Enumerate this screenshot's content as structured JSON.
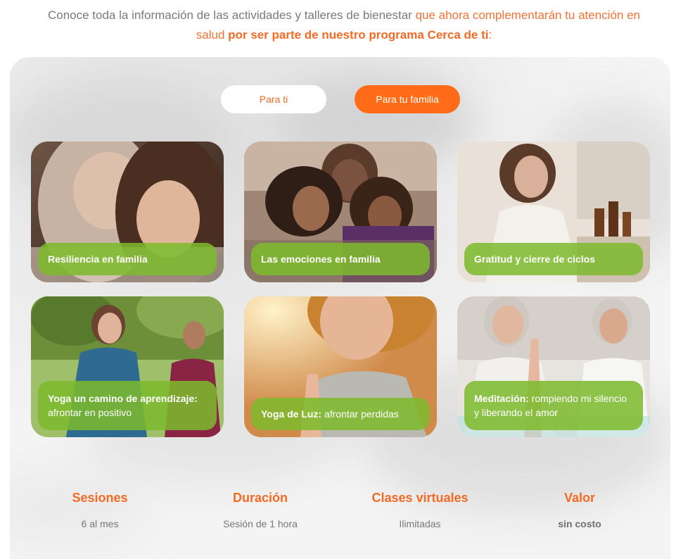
{
  "intro": {
    "part1": "Conoce toda la información de las actividades y talleres de bienestar ",
    "part2": "que ahora complementarán tu atención en salud ",
    "part3": "por ser parte de nuestro programa Cerca de ti",
    "part4": ":"
  },
  "toggles": {
    "para_ti": "Para ti",
    "para_tu_familia": "Para tu familia"
  },
  "cards": [
    {
      "title": "Resiliencia en familia",
      "subtitle": ""
    },
    {
      "title": "Las emociones en familia",
      "subtitle": ""
    },
    {
      "title": "Gratitud y cierre de ciclos",
      "subtitle": ""
    },
    {
      "title": "Yoga un camino de aprendizaje:",
      "subtitle": " afrontar en positivo"
    },
    {
      "title": "Yoga de Luz:",
      "subtitle": " afrontar perdidas"
    },
    {
      "title": "Meditación:",
      "subtitle": " rompiendo mi silencio y liberando el amor"
    }
  ],
  "stats": [
    {
      "title": "Sesiones",
      "value": "6 al mes"
    },
    {
      "title": "Duración",
      "value": "Sesión de 1 hora"
    },
    {
      "title": "Clases virtuales",
      "value": "Ilimitadas"
    },
    {
      "title": "Valor",
      "value": "sin costo"
    }
  ],
  "colors": {
    "accent": "#ff6b17",
    "label_green": "#7dba2c",
    "text_gray": "#7a7a7a"
  }
}
